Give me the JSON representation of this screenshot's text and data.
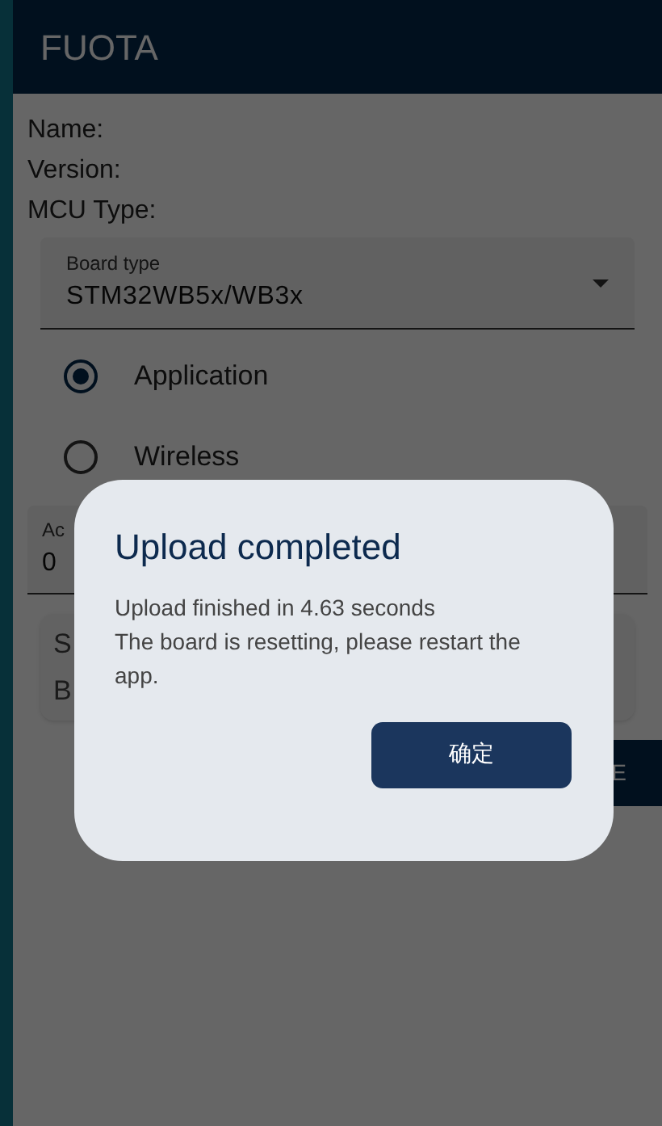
{
  "app_bar": {
    "title": "FUOTA"
  },
  "info": [
    {
      "label": "Name:"
    },
    {
      "label": "Version:"
    },
    {
      "label": "MCU Type:"
    }
  ],
  "board_type": {
    "label": "Board type",
    "value": "STM32WB5x/WB3x"
  },
  "image_type": [
    {
      "label": "Application",
      "selected": true
    },
    {
      "label": "Wireless",
      "selected": false
    }
  ],
  "address_field": {
    "label": "Ac",
    "value": "0"
  },
  "file_card": {
    "lines": [
      "S",
      "B"
    ]
  },
  "action_button": {
    "label": "E"
  },
  "dialog": {
    "title": "Upload completed",
    "message_lines": [
      "Upload finished in 4.63 seconds",
      "The board is resetting, please restart the app."
    ],
    "confirm_button": "确定"
  }
}
